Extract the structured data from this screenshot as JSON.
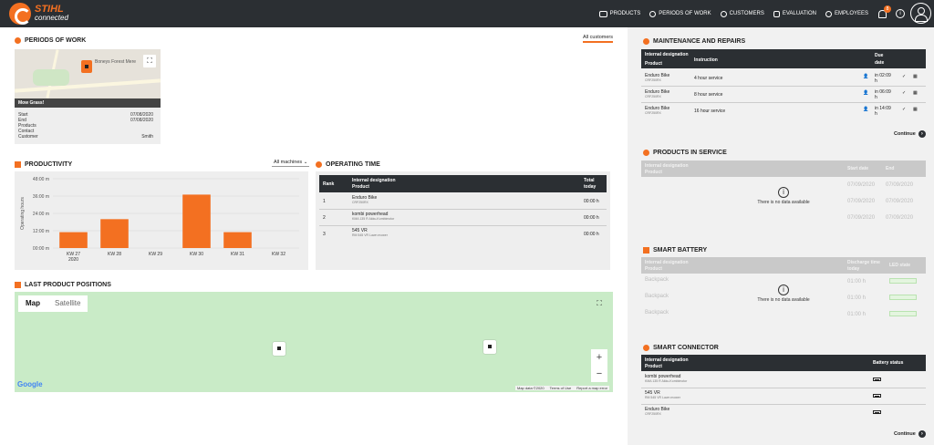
{
  "brand": {
    "name": "STIHL",
    "sub": "connected"
  },
  "nav": [
    "PRODUCTS",
    "PERIODS OF WORK",
    "CUSTOMERS",
    "EVALUATION",
    "EMPLOYEES"
  ],
  "notifications": {
    "count": "8"
  },
  "info_label": "i",
  "periods": {
    "title": "PERIODS OF WORK",
    "link": "All customers",
    "map_label": "Boneys Forest Mere",
    "banner": "Mow Grass!",
    "rows": [
      {
        "k": "Start",
        "v": "07/08/2020"
      },
      {
        "k": "End",
        "v": "07/08/2020"
      },
      {
        "k": "Products",
        "v": ""
      },
      {
        "k": "Contact",
        "v": ""
      },
      {
        "k": "Customer",
        "v": "Smith"
      }
    ]
  },
  "productivity": {
    "title": "PRODUCTIVITY",
    "filter": "All machines"
  },
  "chart_data": {
    "type": "bar",
    "categories": [
      "KW 27",
      "KW 28",
      "KW 29",
      "KW 30",
      "KW 31",
      "KW 32"
    ],
    "x_sublabel": "2020",
    "values": [
      11,
      20,
      0,
      37,
      11,
      0
    ],
    "ylabel": "Operating hours",
    "yticks": [
      "00:00 m",
      "12:00 m",
      "24:00 m",
      "36:00 m",
      "48:00 m"
    ],
    "ylim": [
      0,
      48
    ],
    "color": "#f37021",
    "grid": true
  },
  "operating": {
    "title": "OPERATING TIME",
    "headers": [
      "Rank",
      "Internal designation",
      "Product",
      "Total",
      "today"
    ],
    "rows": [
      {
        "rank": "1",
        "name": "Enduro Bike",
        "sub": "CRF250RX",
        "total": "00:00 h"
      },
      {
        "rank": "2",
        "name": "kombi powerhead",
        "sub": "KMA 135 R Akku-Kombimotor",
        "total": "00:00 h"
      },
      {
        "rank": "3",
        "name": "545 VR",
        "sub": "RM 545 VR Lawn mower",
        "total": "00:00 h"
      }
    ]
  },
  "positions": {
    "title": "LAST PRODUCT POSITIONS",
    "tab_map": "Map",
    "tab_satellite": "Satellite",
    "google": "Google",
    "footer": [
      "Map data ©2020",
      "Terms of Use",
      "Report a map error"
    ],
    "zoom_in": "+",
    "zoom_out": "−"
  },
  "maintenance": {
    "title": "MAINTENANCE AND REPAIRS",
    "headers": [
      "Internal designation",
      "Product",
      "Instruction",
      "Due",
      "date"
    ],
    "rows": [
      {
        "name": "Enduro Bike",
        "sub": "CRF250RX",
        "instr": "4 hour service",
        "due": "in 02:09",
        "unit": "h"
      },
      {
        "name": "Enduro Bike",
        "sub": "CRF250RX",
        "instr": "8 hour service",
        "due": "in 06:09",
        "unit": "h"
      },
      {
        "name": "Enduro Bike",
        "sub": "CRF250RX",
        "instr": "16 hour service",
        "due": "in 14:09",
        "unit": "h"
      }
    ],
    "continue": "Continue"
  },
  "inservice": {
    "title": "PRODUCTS IN SERVICE",
    "headers": [
      "Internal designation",
      "Product",
      "Start date",
      "End"
    ],
    "dates": [
      "07/09/2020",
      "07/09/2020",
      "07/09/2020"
    ],
    "nodata": "There is no data available"
  },
  "battery": {
    "title": "SMART BATTERY",
    "headers": [
      "Internal designation",
      "Product",
      "Discharge time",
      "today",
      "LED state"
    ],
    "rows": [
      "Backpack",
      "Backpack",
      "Backpack"
    ],
    "vals": [
      "01:00 h",
      "01:00 h",
      "01:00 h"
    ],
    "nodata": "There is no data available"
  },
  "connector": {
    "title": "SMART CONNECTOR",
    "headers": [
      "Internal designation",
      "Product",
      "Battery status"
    ],
    "rows": [
      {
        "name": "kombi powerhead",
        "sub": "KMA 135 R Akku-Kombimotor"
      },
      {
        "name": "545 VR",
        "sub": "RM 545 VR Lawn mower"
      },
      {
        "name": "Enduro Bike",
        "sub": "CRF250RX"
      }
    ],
    "continue": "Continue"
  }
}
